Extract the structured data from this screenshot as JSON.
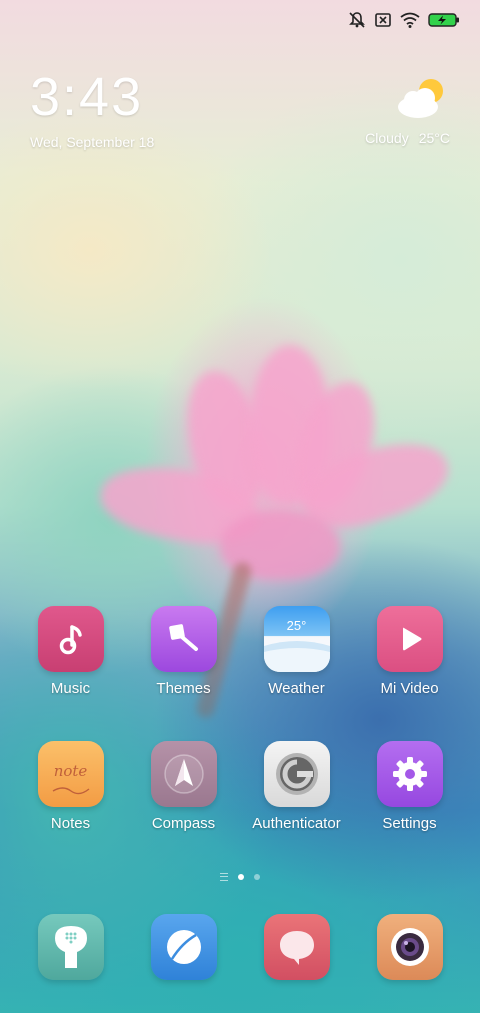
{
  "status_bar": {
    "icons": [
      "mute-icon",
      "sim-error-icon",
      "wifi-icon",
      "battery-charging-icon"
    ]
  },
  "clock": {
    "time": "3:43",
    "date": "Wed, September 18"
  },
  "weather": {
    "condition": "Cloudy",
    "temperature": "25°C",
    "icon": "partly-cloudy-icon"
  },
  "apps": [
    {
      "label": "Music",
      "icon": "music-note-icon",
      "color": "#d8487e"
    },
    {
      "label": "Themes",
      "icon": "paint-brush-icon",
      "color": "#b05ae6"
    },
    {
      "label": "Weather",
      "icon": "weather-app-icon",
      "color": "#4aa8ea",
      "badge": "25°"
    },
    {
      "label": "Mi Video",
      "icon": "play-icon",
      "color": "#e75e8e"
    },
    {
      "label": "Notes",
      "icon": "notes-icon",
      "color": "#f7a94e",
      "badge": "note"
    },
    {
      "label": "Compass",
      "icon": "compass-icon",
      "color": "#a8859b"
    },
    {
      "label": "Authenticator",
      "icon": "authenticator-icon",
      "color": "#e8e8e8"
    },
    {
      "label": "Settings",
      "icon": "gear-icon",
      "color": "#a55ae8"
    }
  ],
  "dock": [
    {
      "icon": "phone-icon",
      "color": "#5fb8ad"
    },
    {
      "icon": "browser-icon",
      "color": "#3d8ee0"
    },
    {
      "icon": "messages-icon",
      "color": "#e0616e"
    },
    {
      "icon": "camera-icon",
      "color": "#e8a06a"
    }
  ],
  "page_indicator": {
    "pages": 2,
    "active": 1
  }
}
